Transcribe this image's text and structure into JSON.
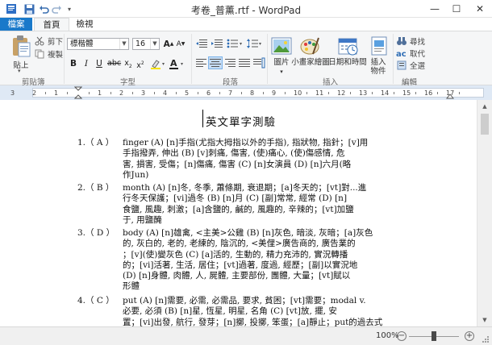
{
  "window": {
    "title": "考卷_普薰.rtf - WordPad",
    "minimize": "—",
    "restore": "☐",
    "close": "✕"
  },
  "tabs": [
    "檔案",
    "首頁",
    "檢視"
  ],
  "ribbon": {
    "clipboard": {
      "paste": "貼上",
      "cut": "剪下",
      "copy": "複製",
      "label": "剪貼簿"
    },
    "font": {
      "family": "標楷體",
      "size": "16",
      "label": "字型"
    },
    "paragraph": {
      "label": "段落"
    },
    "insert": {
      "picture": "圖片",
      "paint": "小畫家繪圖",
      "datetime": "日期和時間",
      "object_line1": "插入",
      "object_line2": "物件",
      "label": "插入"
    },
    "editing": {
      "find": "尋找",
      "replace": "取代",
      "selectall": "全選",
      "label": "編輯"
    }
  },
  "ruler": {
    "numbers": [
      "3",
      "2",
      "1",
      "1",
      "2",
      "3",
      "4",
      "5",
      "6",
      "7",
      "8",
      "9",
      "10",
      "11",
      "12",
      "13",
      "14",
      "15",
      "16",
      "17"
    ]
  },
  "document": {
    "title": "英文單字測驗",
    "questions": [
      {
        "num": "1.（ A ）",
        "lines": [
          "finger (A) [n]手指(尤指大拇指以外的手指), 指狀物, 指針；[v]用",
          "手指撥弄, 伸出 (B) [v]刺痛, 傷害, (使)痛心, (使)傷感情, 危",
          "害, 損害, 受傷；[n]傷痛, 傷害 (C) [n]女演員 (D) [n]六月(略",
          "作Jun)"
        ]
      },
      {
        "num": "2.（ B ）",
        "lines": [
          "month (A) [n]冬, 冬季, 蕭條期, 衰退期；[a]冬天的；[vt]對...進",
          "行冬天保護；[vi]過冬 (B) [n]月 (C) [副]常常, 經常 (D) [n]",
          "食鹽, 風趣, 刺激；[a]含鹽的, 鹹的, 風趣的, 辛辣的；[vt]加鹽",
          "于, 用鹽醃"
        ]
      },
      {
        "num": "3.（ D ）",
        "lines": [
          "body (A) [n]雄禽, <主美>公雞 (B) [n]灰色, 暗淡, 灰暗；[a]灰色",
          "的, 灰白的, 老的, 老練的, 陰沉的, <美俚>廣告商的, 廣告業的",
          "；[v](使)變灰色 (C) [a]活的, 生動的, 精力充沛的, 實況轉播",
          "的；[vi]活著, 生活, 居住；[vt]過著, 度過, 經歷；[副]以實況地",
          "(D) [n]身體, 肉體, 人, 屍體, 主要部份, 團體, 大量；[vt]賦以",
          "形體"
        ]
      },
      {
        "num": "4.（ C ）",
        "lines": [
          "put (A) [n]需要, 必需, 必需品, 要求, 貧困；[vt]需要；modal v.",
          "必要, 必須 (B) [n]星, 恆星, 明星, 名角 (C) [vt]放, 擺, 安",
          "置；[vi]出發, 航行, 發芽；[n]擲, 投擲, 笨蛋；[a]靜止；put的過去式"
        ]
      }
    ]
  },
  "status": {
    "zoom": "100%",
    "zoom_level_percent": 100,
    "zoom_out": "−",
    "zoom_in": "+"
  }
}
